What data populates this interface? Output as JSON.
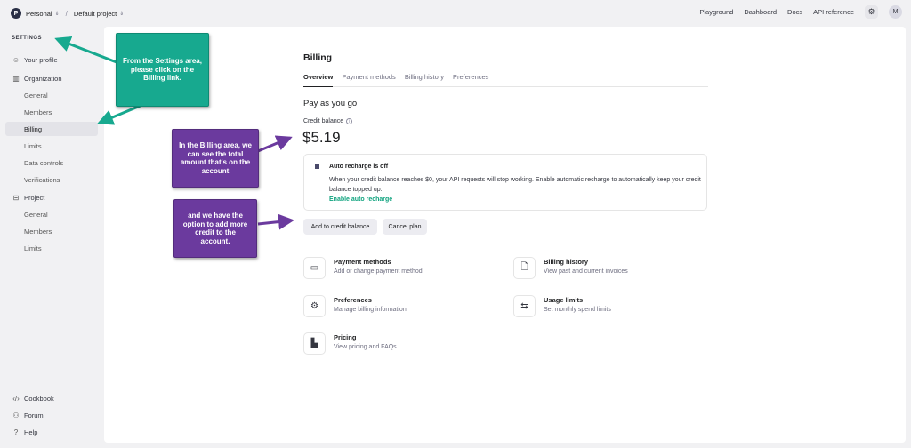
{
  "topbar": {
    "org_initial": "P",
    "org": "Personal",
    "project": "Default project",
    "links": [
      "Playground",
      "Dashboard",
      "Docs",
      "API reference"
    ],
    "avatar": "M",
    "settings_icon": "gear-icon"
  },
  "sidebar": {
    "heading": "SETTINGS",
    "items": [
      {
        "label": "Your profile",
        "icon": "person-icon"
      },
      {
        "label": "Organization",
        "icon": "building-icon"
      },
      {
        "label": "General"
      },
      {
        "label": "Members"
      },
      {
        "label": "Billing",
        "active": true
      },
      {
        "label": "Limits"
      },
      {
        "label": "Data controls"
      },
      {
        "label": "Verifications"
      },
      {
        "label": "Project",
        "icon": "briefcase-icon"
      },
      {
        "label": "General"
      },
      {
        "label": "Members"
      },
      {
        "label": "Limits"
      }
    ],
    "footer": [
      {
        "label": "Cookbook",
        "icon": "code-icon"
      },
      {
        "label": "Forum",
        "icon": "people-icon"
      },
      {
        "label": "Help",
        "icon": "help-icon"
      }
    ]
  },
  "billing": {
    "title": "Billing",
    "tabs": [
      "Overview",
      "Payment methods",
      "Billing history",
      "Preferences"
    ],
    "section": "Pay as you go",
    "balance_label": "Credit balance",
    "balance": "$5.19",
    "recharge": {
      "title": "Auto recharge is off",
      "desc": "When your credit balance reaches $0, your API requests will stop working. Enable automatic recharge to automatically keep your credit balance topped up.",
      "link": "Enable auto recharge"
    },
    "buttons": {
      "add": "Add to credit balance",
      "cancel": "Cancel plan"
    },
    "tiles": [
      {
        "title": "Payment methods",
        "desc": "Add or change payment method",
        "icon": "credit-card-icon"
      },
      {
        "title": "Billing history",
        "desc": "View past and current invoices",
        "icon": "document-icon"
      },
      {
        "title": "Preferences",
        "desc": "Manage billing information",
        "icon": "settings-icon"
      },
      {
        "title": "Usage limits",
        "desc": "Set monthly spend limits",
        "icon": "sliders-icon"
      },
      {
        "title": "Pricing",
        "desc": "View pricing and FAQs",
        "icon": "bar-chart-icon"
      }
    ]
  },
  "annotations": {
    "settings_note": "From the Settings area, please click on the Billing link.",
    "balance_note": "In the Billing area, we can see the total amount that's on the account",
    "credit_note": "and we have the option to add more credit to the account.",
    "colors": {
      "teal": "#17a98f",
      "purple": "#6b3a9e"
    }
  }
}
